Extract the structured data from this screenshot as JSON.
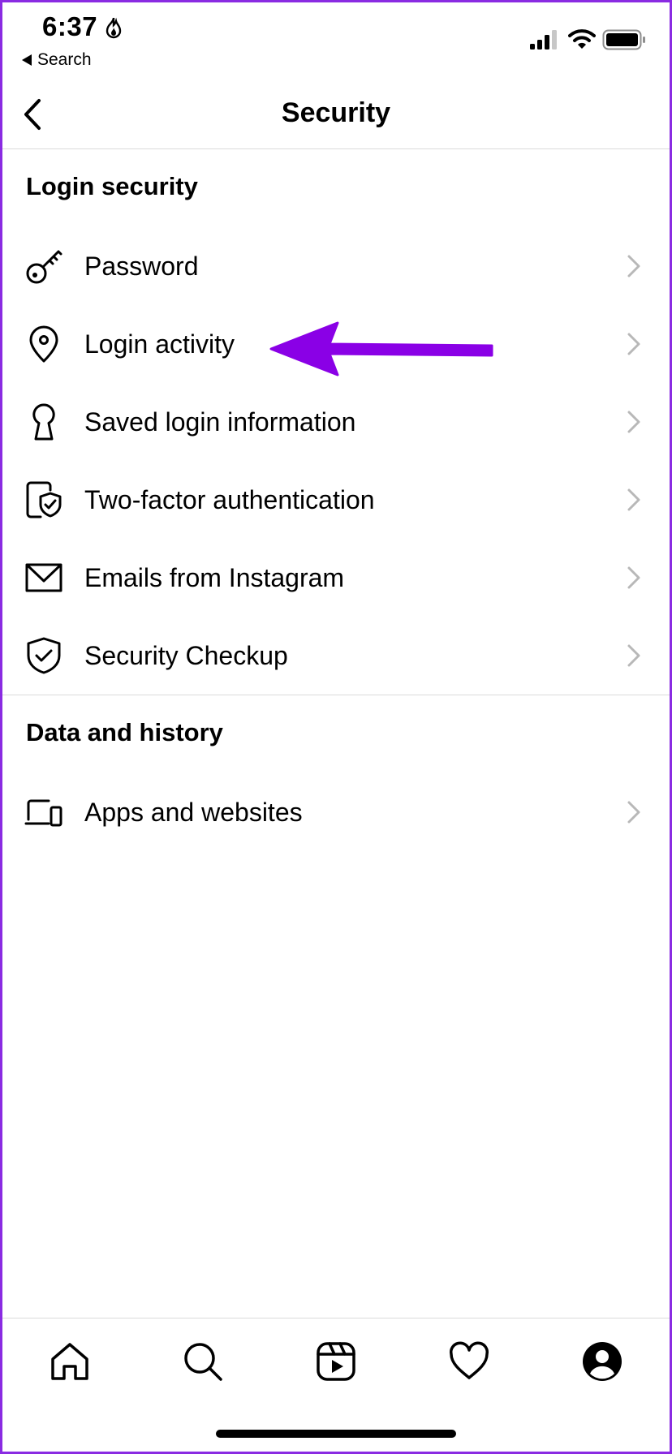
{
  "status_bar": {
    "time": "6:37",
    "back_app_label": "Search"
  },
  "header": {
    "title": "Security"
  },
  "sections": [
    {
      "title": "Login security",
      "items": [
        {
          "label": "Password",
          "icon": "key-icon"
        },
        {
          "label": "Login activity",
          "icon": "location-pin-icon"
        },
        {
          "label": "Saved login information",
          "icon": "keyhole-icon"
        },
        {
          "label": "Two-factor authentication",
          "icon": "phone-shield-icon"
        },
        {
          "label": "Emails from Instagram",
          "icon": "envelope-icon"
        },
        {
          "label": "Security Checkup",
          "icon": "shield-check-icon"
        }
      ]
    },
    {
      "title": "Data and history",
      "items": [
        {
          "label": "Apps and websites",
          "icon": "devices-icon"
        }
      ]
    }
  ],
  "tab_bar": {
    "tabs": [
      "home-icon",
      "search-icon",
      "reels-icon",
      "heart-icon",
      "profile-icon"
    ]
  },
  "colors": {
    "annotation_arrow": "#8a00e6",
    "chevron": "#b8b8b8",
    "divider": "#dbdbdb"
  }
}
